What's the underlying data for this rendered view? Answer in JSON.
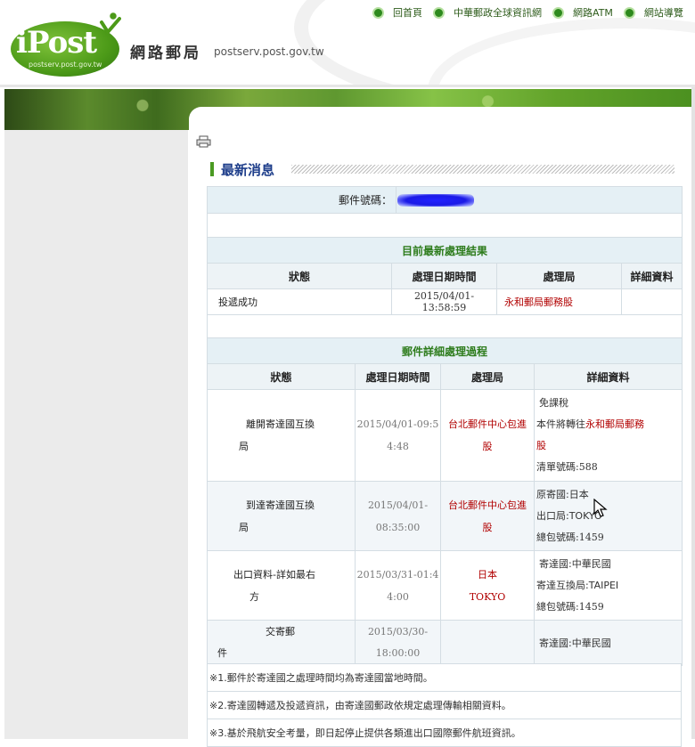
{
  "header": {
    "logo_word": "iPost",
    "logo_domain": "postserv.post.gov.tw",
    "site_title": "網路郵局",
    "site_domain": "postserv.post.gov.tw",
    "nav": [
      {
        "label": "回首頁"
      },
      {
        "label": "中華郵政全球資訊網"
      },
      {
        "label": "網路ATM"
      },
      {
        "label": "網站導覽"
      }
    ]
  },
  "section_title": "最新消息",
  "tracking": {
    "label": "郵件號碼："
  },
  "latest": {
    "title": "目前最新處理結果",
    "columns": [
      "狀態",
      "處理日期時間",
      "處理局",
      "詳細資料"
    ],
    "row": {
      "status": "投遞成功",
      "datetime": "2015/04/01-13:58:59",
      "office": "永和郵局郵務股",
      "detail": ""
    }
  },
  "history": {
    "title": "郵件詳細處理過程",
    "columns": [
      "狀態",
      "處理日期時間",
      "處理局",
      "詳細資料"
    ],
    "rows": [
      {
        "status_l1": "離開寄達國互換",
        "status_l2": "局",
        "dt_l1": "2015/04/01-09:5",
        "dt_l2": "4:48",
        "office_l1": "台北郵件中心包進",
        "office_l2": "股",
        "detail": [
          "免課稅",
          "本件將轉往",
          "永和郵局郵務",
          "股",
          "清單號碼:588"
        ]
      },
      {
        "status_l1": "到達寄達國互換",
        "status_l2": "局",
        "dt_l1": "2015/04/01-",
        "dt_l2": "08:35:00",
        "office_l1": "台北郵件中心包進",
        "office_l2": "股",
        "detail": [
          "原寄國:日本",
          "出口局:TOKYO",
          "總包號碼:1459"
        ]
      },
      {
        "status_l1": "出口資料-詳如最右",
        "status_l2": "方",
        "dt_l1": "2015/03/31-01:4",
        "dt_l2": "4:00",
        "office_l1": "日本",
        "office_l2": "TOKYO",
        "detail": [
          "寄達國:中華民國",
          "寄達互換局:TAIPEI",
          "總包號碼:1459"
        ]
      },
      {
        "status_l1": "交寄郵",
        "status_l2": "件",
        "dt_l1": "2015/03/30-",
        "dt_l2": "18:00:00",
        "office_l1": "",
        "office_l2": "",
        "detail": [
          "寄達國:中華民國"
        ]
      }
    ]
  },
  "notes": [
    "※1.郵件於寄達國之處理時間均為寄達國當地時間。",
    "※2.寄達國轉遞及投遞資訊，由寄達國郵政依規定處理傳輸相關資料。",
    "※3.基於飛航安全考量，即日起停止提供各類進出口國際郵件航班資訊。"
  ],
  "colors": {
    "accent_green": "#2d7c1c",
    "title_blue": "#1d3d8a",
    "office_red": "#b10000",
    "header_blue_bg": "#e5f0f5"
  }
}
